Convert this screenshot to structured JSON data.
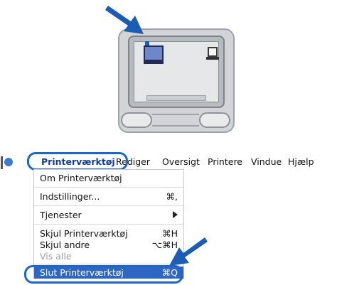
{
  "menubar": {
    "items": [
      {
        "label": "Printerværktøj",
        "active": true
      },
      {
        "label": "Rediger"
      },
      {
        "label": "Oversigt"
      },
      {
        "label": "Printere"
      },
      {
        "label": "Vindue"
      },
      {
        "label": "Hjælp"
      }
    ]
  },
  "menu": {
    "items": [
      {
        "label": "Om Printerværktøj",
        "shortcut": ""
      },
      {
        "label": "Indstillinger...",
        "shortcut": "⌘,"
      },
      {
        "label": "Tjenester",
        "shortcut": ""
      },
      {
        "label": "Skjul Printerværktøj",
        "shortcut": "⌘H"
      },
      {
        "label": "Skjul andre",
        "shortcut": "⌥⌘H"
      },
      {
        "label": "Vis alle",
        "shortcut": "",
        "disabled": true
      },
      {
        "label": "Slut Printerværktøj",
        "shortcut": "⌘Q",
        "selected": true
      }
    ]
  },
  "colors": {
    "accent": "#1d67c9",
    "selection": "#2e67c3",
    "arrow": "#1b5db5"
  },
  "icons": [
    "apple-icon",
    "submenu-arrow-icon",
    "monitor-icon",
    "printer-icon",
    "callout-arrow-icon"
  ]
}
